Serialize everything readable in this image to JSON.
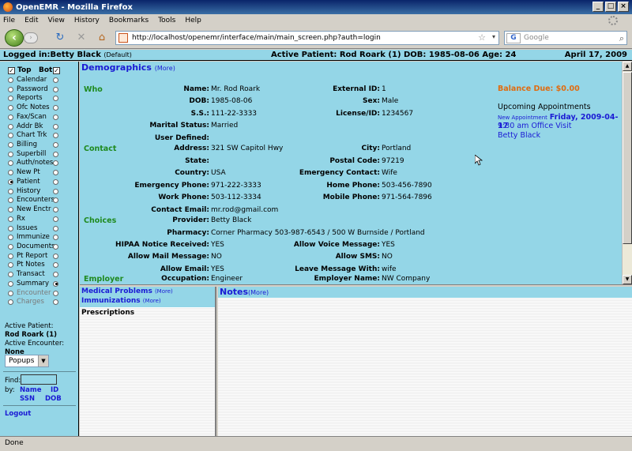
{
  "window": {
    "title": "OpenEMR - Mozilla Firefox"
  },
  "menu": [
    "File",
    "Edit",
    "View",
    "History",
    "Bookmarks",
    "Tools",
    "Help"
  ],
  "browser": {
    "url": "http://localhost/openemr/interface/main/main_screen.php?auth=login",
    "search_placeholder": "Google",
    "search_engine": "G",
    "status": "Done"
  },
  "header": {
    "logged_in_label": "Logged in:",
    "user": "Betty Black",
    "user_suffix": "(Default)",
    "active_patient": "Active Patient: Rod Roark (1) DOB: 1985-08-06 Age: 24",
    "date": "April 17, 2009"
  },
  "leftnav": {
    "top_label": "Top",
    "bot_label": "Bot",
    "items": [
      {
        "label": "Calendar",
        "left_on": false,
        "right_on": false,
        "disabled": false
      },
      {
        "label": "Password",
        "left_on": false,
        "right_on": false,
        "disabled": false
      },
      {
        "label": "Reports",
        "left_on": false,
        "right_on": false,
        "disabled": false
      },
      {
        "label": "Ofc Notes",
        "left_on": false,
        "right_on": false,
        "disabled": false
      },
      {
        "label": "Fax/Scan",
        "left_on": false,
        "right_on": false,
        "disabled": false
      },
      {
        "label": "Addr Bk",
        "left_on": false,
        "right_on": false,
        "disabled": false
      },
      {
        "label": "Chart Trk",
        "left_on": false,
        "right_on": false,
        "disabled": false
      },
      {
        "label": "Billing",
        "left_on": false,
        "right_on": false,
        "disabled": false
      },
      {
        "label": "Superbill",
        "left_on": false,
        "right_on": false,
        "disabled": false
      },
      {
        "label": "Auth/notes",
        "left_on": false,
        "right_on": false,
        "disabled": false
      },
      {
        "label": "New Pt",
        "left_on": false,
        "right_on": false,
        "disabled": false
      },
      {
        "label": "Patient",
        "left_on": true,
        "right_on": false,
        "disabled": false
      },
      {
        "label": "History",
        "left_on": false,
        "right_on": false,
        "disabled": false
      },
      {
        "label": "Encounters",
        "left_on": false,
        "right_on": false,
        "disabled": false
      },
      {
        "label": "New Enctr",
        "left_on": false,
        "right_on": false,
        "disabled": false
      },
      {
        "label": "Rx",
        "left_on": false,
        "right_on": false,
        "disabled": false
      },
      {
        "label": "Issues",
        "left_on": false,
        "right_on": false,
        "disabled": false
      },
      {
        "label": "Immunize",
        "left_on": false,
        "right_on": false,
        "disabled": false
      },
      {
        "label": "Documents",
        "left_on": false,
        "right_on": false,
        "disabled": false
      },
      {
        "label": "Pt Report",
        "left_on": false,
        "right_on": false,
        "disabled": false
      },
      {
        "label": "Pt Notes",
        "left_on": false,
        "right_on": false,
        "disabled": false
      },
      {
        "label": "Transact",
        "left_on": false,
        "right_on": false,
        "disabled": false
      },
      {
        "label": "Summary",
        "left_on": false,
        "right_on": true,
        "disabled": false
      },
      {
        "label": "Encounter",
        "left_on": false,
        "right_on": false,
        "disabled": true
      },
      {
        "label": "Charges",
        "left_on": false,
        "right_on": false,
        "disabled": true
      }
    ],
    "active_patient_label": "Active Patient:",
    "active_patient": "Rod Roark (1)",
    "active_encounter_label": "Active Encounter:",
    "active_encounter": "None",
    "popups": "Popups",
    "find_label": "Find:",
    "by_label": "by:",
    "find_name": "Name",
    "find_id": "ID",
    "find_ssn": "SSN",
    "find_dob": "DOB",
    "logout": "Logout"
  },
  "demographics": {
    "title": "Demographics",
    "more": "(More)",
    "sections": {
      "who": "Who",
      "contact": "Contact",
      "choices": "Choices",
      "employer": "Employer"
    },
    "fields": [
      {
        "label": "Name:",
        "value": "Mr. Rod  Roark"
      },
      {
        "label": "External ID:",
        "value": "1"
      },
      {
        "label": "DOB:",
        "value": "1985-08-06"
      },
      {
        "label": "Sex:",
        "value": "Male"
      },
      {
        "label": "S.S.:",
        "value": "111-22-3333"
      },
      {
        "label": "License/ID:",
        "value": "1234567"
      },
      {
        "label": "Marital Status:",
        "value": "Married"
      },
      {
        "label": "User Defined:",
        "value": ""
      },
      {
        "label": "Address:",
        "value": "321 SW Capitol Hwy"
      },
      {
        "label": "City:",
        "value": "Portland"
      },
      {
        "label": "State:",
        "value": ""
      },
      {
        "label": "Postal Code:",
        "value": "97219"
      },
      {
        "label": "Country:",
        "value": "USA"
      },
      {
        "label": "Emergency Contact:",
        "value": "Wife"
      },
      {
        "label": "Emergency Phone:",
        "value": "971-222-3333"
      },
      {
        "label": "Home Phone:",
        "value": "503-456-7890"
      },
      {
        "label": "Work Phone:",
        "value": "503-112-3334"
      },
      {
        "label": "Mobile Phone:",
        "value": "971-564-7896"
      },
      {
        "label": "Contact Email:",
        "value": "mr.rod@gmail.com"
      },
      {
        "label": "Provider:",
        "value": "Betty Black"
      },
      {
        "label": "Pharmacy:",
        "value": "Corner Pharmacy 503-987-6543 / 500 W Burnside / Portland"
      },
      {
        "label": "HIPAA Notice Received:",
        "value": "YES"
      },
      {
        "label": "Allow Voice Message:",
        "value": "YES"
      },
      {
        "label": "Allow Mail Message:",
        "value": "NO"
      },
      {
        "label": "Allow SMS:",
        "value": "NO"
      },
      {
        "label": "Allow Email:",
        "value": "YES"
      },
      {
        "label": "Leave Message With:",
        "value": "wife"
      },
      {
        "label": "Occupation:",
        "value": "Engineer"
      },
      {
        "label": "Employer Name:",
        "value": "NW Company"
      }
    ],
    "balance_due": "Balance Due: $0.00",
    "upcoming_title": "Upcoming Appointments",
    "appointment": {
      "new_label": "New Appointment",
      "date": "Friday, 2009-04-17",
      "time_desc": "9:30 am Office Visit",
      "provider": "Betty Black"
    }
  },
  "lower": {
    "medical_problems": "Medical Problems",
    "immunizations": "Immunizations",
    "more": "(More)",
    "prescriptions": "Prescriptions",
    "notes_title": "Notes",
    "notes_more": "(More)"
  }
}
